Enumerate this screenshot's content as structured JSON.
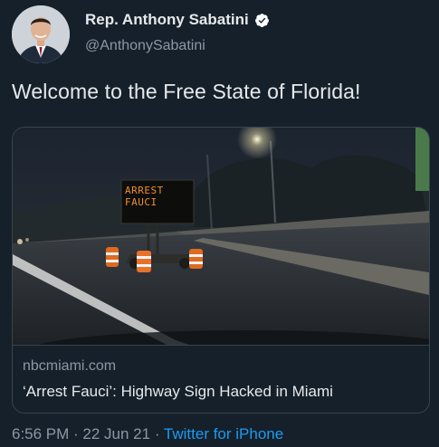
{
  "author": {
    "display_name": "Rep. Anthony Sabatini",
    "handle": "@AnthonySabatini",
    "verified": true,
    "avatar_icon": "profile-photo"
  },
  "tweet": {
    "text": "Welcome to the Free State of Florida!"
  },
  "link_card": {
    "domain": "nbcmiami.com",
    "title": "‘Arrest Fauci’: Highway Sign Hacked in Miami",
    "image": {
      "sign_line_1": "ARREST",
      "sign_line_2": "FAUCI"
    }
  },
  "meta": {
    "time": "6:56 PM",
    "separator_1": " · ",
    "date": "22 Jun 21",
    "separator_2": " · ",
    "source": "Twitter for iPhone"
  },
  "colors": {
    "background": "#15202b",
    "primary_text": "#e7e9ea",
    "secondary_text": "#8b98a5",
    "link": "#1d9bf0",
    "verified_badge": "#ffffff",
    "sign_text": "#f0902a"
  }
}
